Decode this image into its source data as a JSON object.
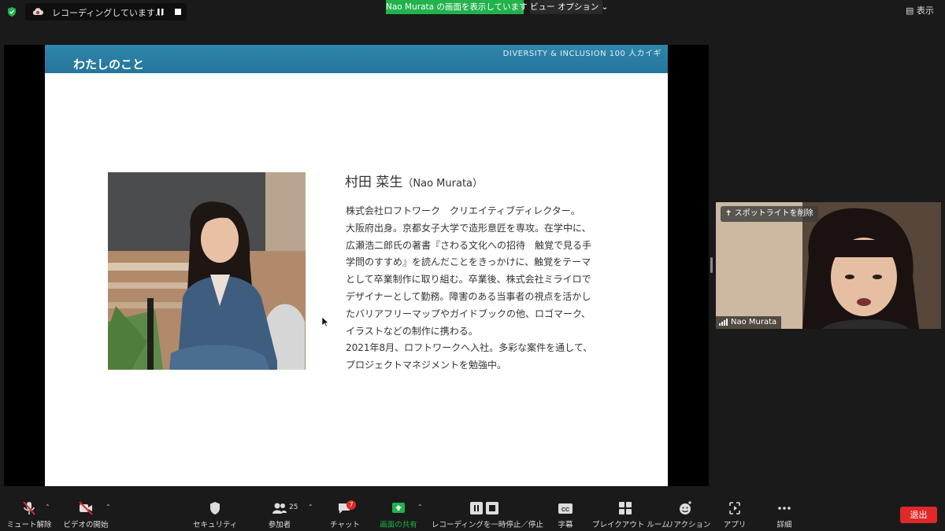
{
  "top_bar": {
    "recording_text": "レコーディングしています...",
    "share_banner": "Nao  Murata の画面を表示しています",
    "view_options": "ビュー オプション ⌄",
    "view_button": "表示"
  },
  "slide": {
    "title": "わたしのこと",
    "brand": "DIVERSITY & INCLUSION 100 人カイギ",
    "name": "村田 菜生",
    "name_romaji": "（Nao Murata）",
    "bio_lines": [
      "株式会社ロフトワーク　クリエイティブディレクター。",
      "大阪府出身。京都女子大学で造形意匠を専攻。在学中に、",
      "広瀬浩二郎氏の著書『さわる文化への招待　触覚で見る手",
      "学問のすすめ』を読んだことをきっかけに、触覚をテーマ",
      "として卒業制作に取り組む。卒業後、株式会社ミライロで",
      "デザイナーとして勤務。障害のある当事者の視点を活かし",
      "たバリアフリーマップやガイドブックの他、ロゴマーク、",
      "イラストなどの制作に携わる。",
      "2021年8月、ロフトワークへ入社。多彩な案件を通して、",
      "プロジェクトマネジメントを勉強中。"
    ]
  },
  "video": {
    "spotlight_label": "スポットライトを削除",
    "participant_name": "Nao Murata"
  },
  "toolbar": {
    "mute": "ミュート解除",
    "video": "ビデオの開始",
    "security": "セキュリティ",
    "participants": "参加者",
    "participants_count": "25",
    "chat": "チャット",
    "chat_badge": "7",
    "share": "画面の共有",
    "recording": "レコーディングを一時停止／停止",
    "cc": "字幕",
    "breakout": "ブレイクアウト ルーム",
    "reactions": "リアクション",
    "apps": "アプリ",
    "more": "詳細",
    "leave": "退出"
  },
  "colors": {
    "share_green": "#22b24c",
    "leave_red": "#e02828",
    "slide_header_blue": "#2a7ea6"
  }
}
